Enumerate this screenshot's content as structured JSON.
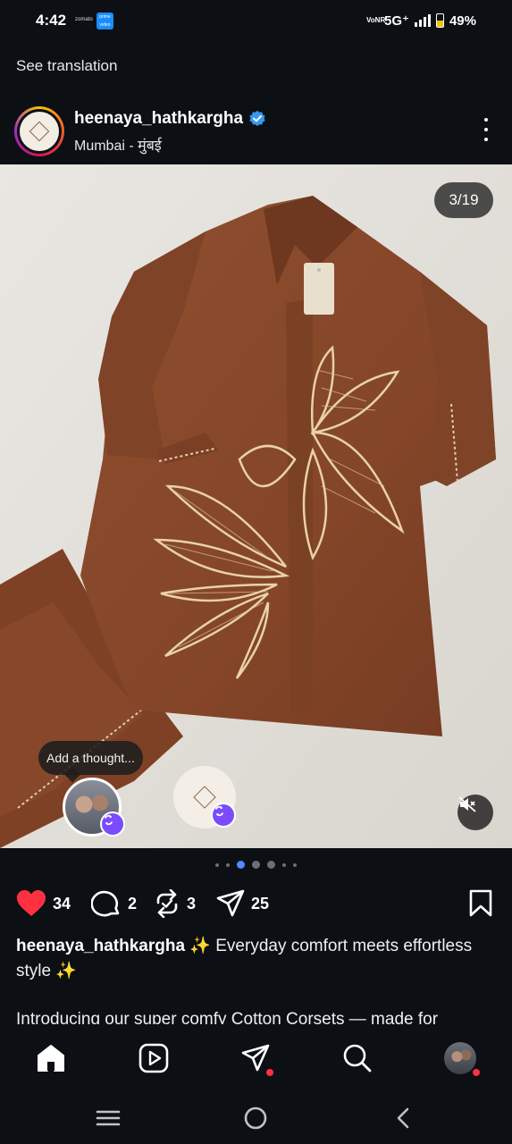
{
  "status_bar": {
    "time": "4:42",
    "mini_app_label": "zomato",
    "prime_label": "prime video",
    "network_label": "VoNR",
    "network_type": "5G⁺",
    "battery": "49%",
    "battery_level": 0.49
  },
  "see_translation": "See translation",
  "post": {
    "username": "heenaya_hathkargha",
    "verified": true,
    "location": "Mumbai - मुंबई",
    "avatar_icon": "brand-logo-icon",
    "carousel_counter": "3/19",
    "add_thought": "Add a thought...",
    "carousel_dots": {
      "count": 7,
      "active_index": 2
    },
    "colors": {
      "like": "#ff3040",
      "accent_dot": "#4d8cff",
      "repost_badge": "#7a4bff",
      "garment": "#8a4a2c",
      "embroidery": "#e8d3a6"
    }
  },
  "actions": {
    "likes": "34",
    "comments": "2",
    "reposts": "3",
    "shares": "25"
  },
  "caption": {
    "username": "heenaya_hathkargha",
    "line1": " ✨ Everyday comfort meets effortless style ✨",
    "line2": "Introducing our super comfy Cotton Corsets — made for"
  },
  "bottom_nav": [
    "home-icon",
    "reels-icon",
    "direct-icon",
    "search-icon",
    "profile-avatar"
  ],
  "system_nav": [
    "recents-icon",
    "home-circle-icon",
    "back-icon"
  ]
}
